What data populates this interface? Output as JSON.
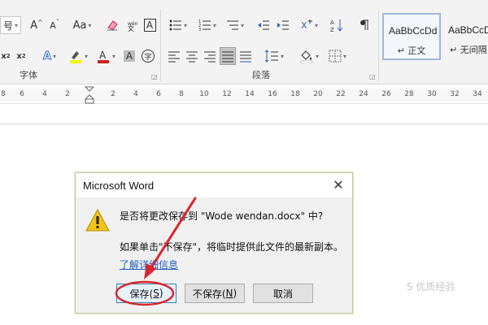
{
  "ribbon": {
    "font_group_label": "字体",
    "paragraph_group_label": "段落",
    "font_size_dropdown_label": "号",
    "change_case_label": "Aa",
    "styles": [
      {
        "sample": "AaBbCcDd",
        "name": "正文",
        "selected": true
      },
      {
        "sample": "AaBbCcDd",
        "name": "无间隔",
        "selected": false
      }
    ]
  },
  "ruler": {
    "ticks_left": [
      "8",
      "6",
      "4",
      "2"
    ],
    "ticks_right": [
      "2",
      "4",
      "6",
      "8",
      "10",
      "12",
      "14",
      "16",
      "18",
      "20",
      "22",
      "24",
      "26",
      "28",
      "30",
      "32",
      "34"
    ]
  },
  "dialog": {
    "title": "Microsoft Word",
    "close_glyph": "✕",
    "message": "是否将更改保存到 \"Wode wendan.docx\" 中?",
    "detail": "如果单击\"不保存\"，将临时提供此文件的最新副本。",
    "more_info_link": "了解详细信息",
    "buttons": {
      "save": {
        "label": "保存(",
        "mnemonic": "S",
        "suffix": ")"
      },
      "dont_save": {
        "label": "不保存(",
        "mnemonic": "N",
        "suffix": ")"
      },
      "cancel": {
        "label": "取消"
      }
    }
  },
  "annotation": {
    "color": "#d9262e"
  },
  "watermark": {
    "text": "S 优质经验"
  }
}
